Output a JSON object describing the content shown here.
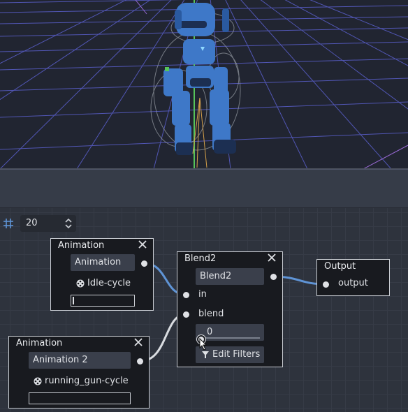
{
  "graph": {
    "zoom": {
      "value": "20",
      "icon": "snap-grid-icon"
    },
    "nodes": {
      "animation1": {
        "title": "Animation",
        "name_field": "Animation",
        "clip": "Idle-cycle"
      },
      "animation2": {
        "title": "Animation",
        "name_field": "Animation 2",
        "clip": "running_gun-cycle"
      },
      "blend2": {
        "title": "Blend2",
        "name_field": "Blend2",
        "in_label": "in",
        "blend_label": "blend",
        "amount": "0",
        "edit_filters": "Edit Filters"
      },
      "output": {
        "title": "Output",
        "output_label": "output"
      }
    },
    "colors": {
      "wire_primary": "#5f94d6",
      "wire_secondary": "#d9dce0",
      "node_bg": "#181a1f"
    }
  }
}
